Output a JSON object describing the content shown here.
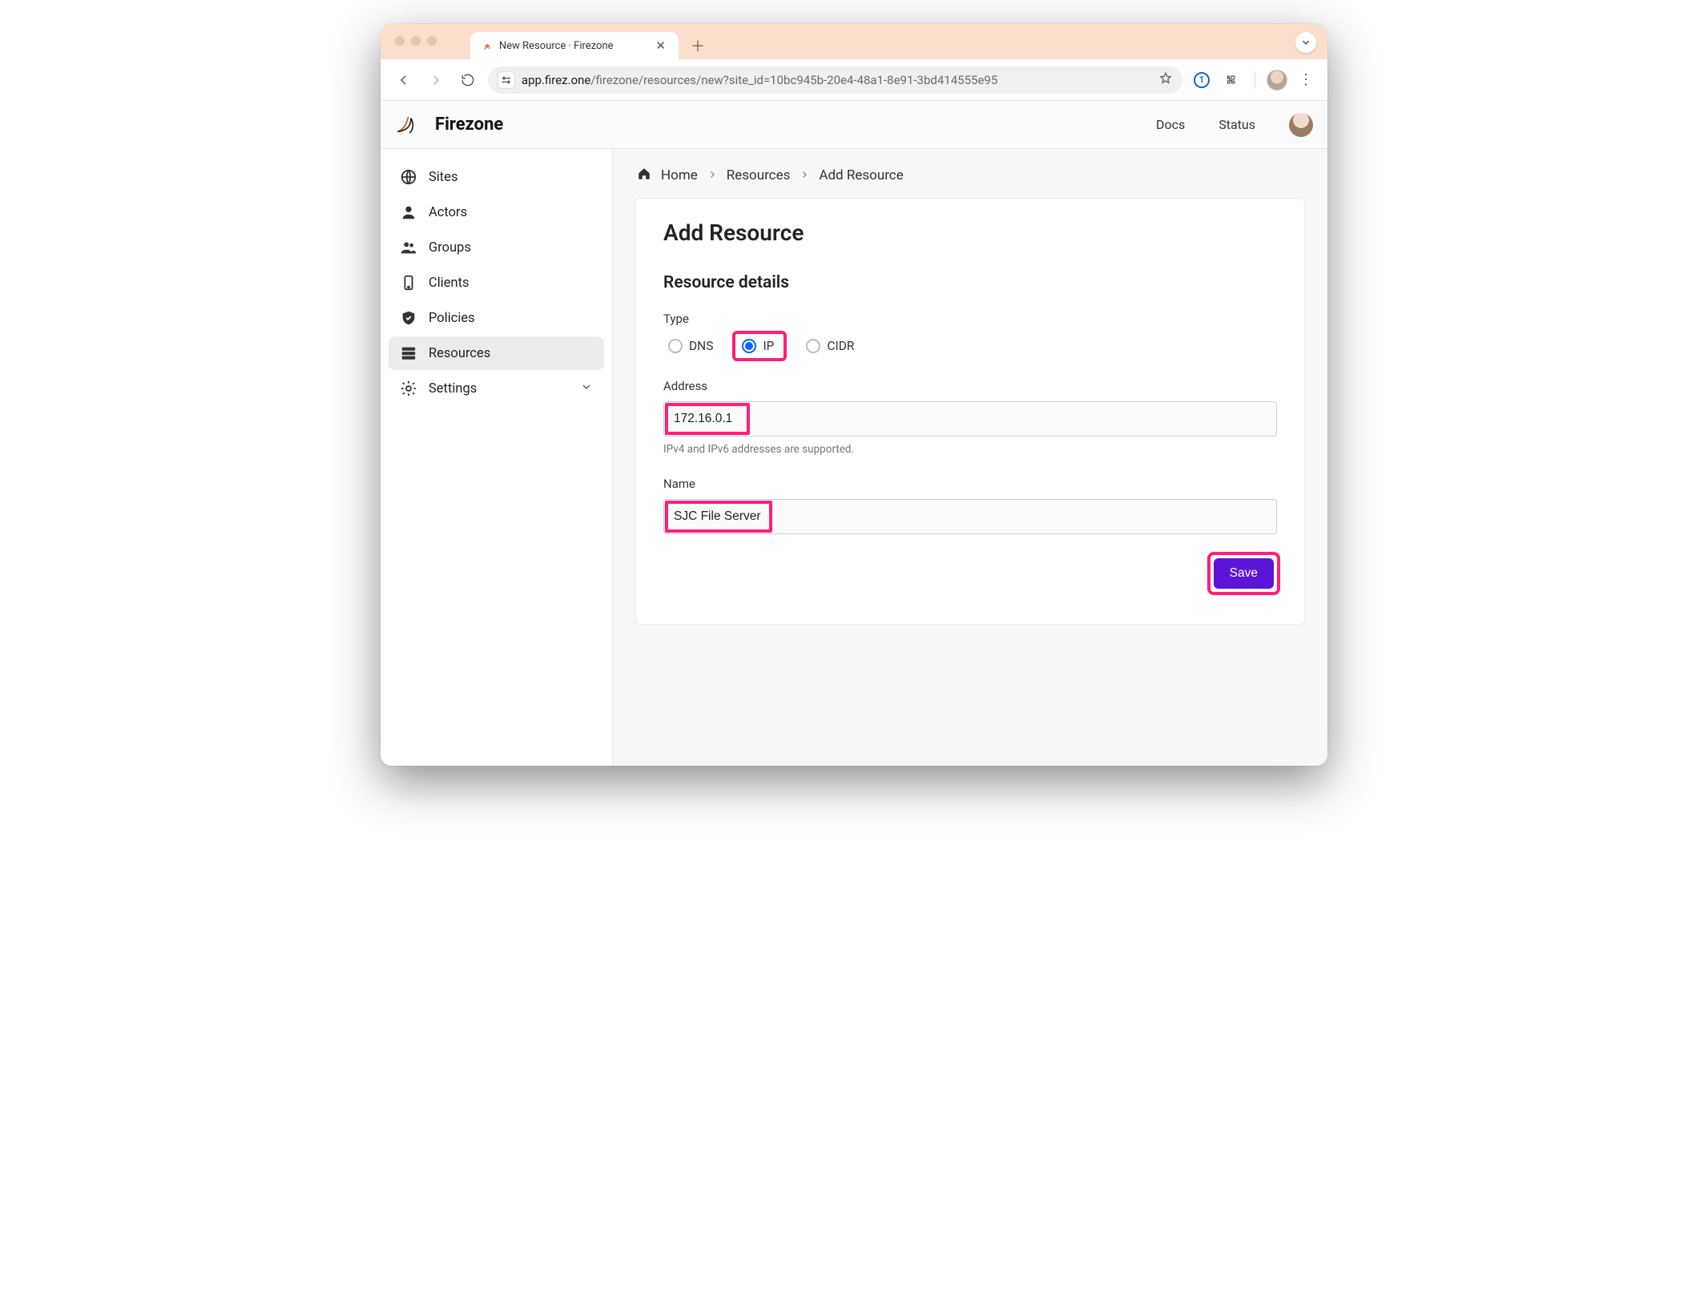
{
  "browser": {
    "tab_title": "New Resource · Firezone",
    "url_host": "app.firez.one",
    "url_path": "/firezone/resources/new?site_id=10bc945b-20e4-48a1-8e91-3bd414555e95"
  },
  "header": {
    "brand": "Firezone",
    "links": {
      "docs": "Docs",
      "status": "Status"
    }
  },
  "sidebar": {
    "items": [
      {
        "key": "sites",
        "label": "Sites"
      },
      {
        "key": "actors",
        "label": "Actors"
      },
      {
        "key": "groups",
        "label": "Groups"
      },
      {
        "key": "clients",
        "label": "Clients"
      },
      {
        "key": "policies",
        "label": "Policies"
      },
      {
        "key": "resources",
        "label": "Resources",
        "active": true
      },
      {
        "key": "settings",
        "label": "Settings",
        "expandable": true
      }
    ]
  },
  "breadcrumbs": {
    "home": "Home",
    "resources": "Resources",
    "current": "Add Resource"
  },
  "page": {
    "title": "Add Resource",
    "section": "Resource details",
    "type_label": "Type",
    "type_options": {
      "dns": "DNS",
      "ip": "IP",
      "cidr": "CIDR"
    },
    "type_selected": "ip",
    "address_label": "Address",
    "address_value": "172.16.0.1",
    "address_hint": "IPv4 and IPv6 addresses are supported.",
    "name_label": "Name",
    "name_value": "SJC File Server",
    "save_label": "Save"
  },
  "highlights": {
    "radio_ip": true,
    "address_value": true,
    "name_value": true,
    "save_button": true
  },
  "colors": {
    "accent_purple": "#5b14d8",
    "radio_blue": "#0b63ff",
    "highlight_pink": "#ff1f7a",
    "titlebar_peach": "#fbdfcd"
  }
}
